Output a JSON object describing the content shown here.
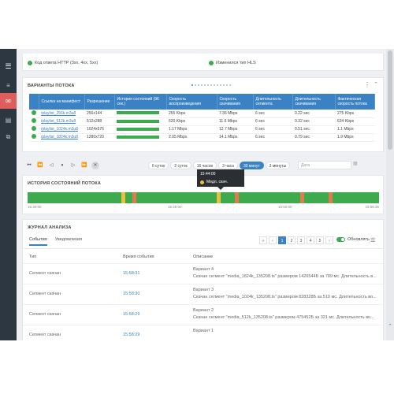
{
  "sidebar": {
    "items": [
      {
        "icon": "hamburger-menu-icon",
        "glyph": "☰"
      },
      {
        "icon": "list-icon",
        "glyph": "≡"
      },
      {
        "icon": "mail-icon",
        "glyph": "✉",
        "active": true
      },
      {
        "icon": "document-icon",
        "glyph": "▤"
      },
      {
        "icon": "copy-icon",
        "glyph": "⧉"
      }
    ]
  },
  "legend": {
    "http_code": "Код ответа HTTP (3xx, 4xx, 5xx)",
    "hls_type": "Изменился тип HLS"
  },
  "variants": {
    "title": "ВАРИАНТЫ ПОТОКА",
    "headers": [
      "",
      "Ссылка на манифест",
      "Разрешение",
      "История состояний (96 сек.)",
      "Скорость воспроизведения",
      "Скорость скачивания",
      "Длительность сегмента",
      "Длительность скачивания",
      "Фактическая скорость потока"
    ],
    "rows": [
      {
        "link": "/playlist_256k.m3u8",
        "resolution": "256x144",
        "play_speed": "255 Kbps",
        "dl_speed": "7.36 Mbps",
        "seg_dur": "6 sec",
        "dl_dur": "0.22 sec",
        "actual": "275 Kbps"
      },
      {
        "link": "/playlist_512k.m3u8",
        "resolution": "512x288",
        "play_speed": "620 Kbps",
        "dl_speed": "11.6 Mbps",
        "seg_dur": "6 sec",
        "dl_dur": "0.32 sec",
        "actual": "634 Kbps"
      },
      {
        "link": "/playlist_1024k.m3u8",
        "resolution": "1024x576",
        "play_speed": "1.17 Mbps",
        "dl_speed": "12.7 Mbps",
        "seg_dur": "6 sec",
        "dl_dur": "0.51 sec",
        "actual": "1.1 Mbps"
      },
      {
        "link": "/playlist_1824k.m3u8",
        "resolution": "1280x720",
        "play_speed": "2.05 Mbps",
        "dl_speed": "14.1 Mbps",
        "seg_dur": "6 sec",
        "dl_dur": "0.79 sec",
        "actual": "1.9 Mbps"
      }
    ]
  },
  "toolbar": {
    "ranges": [
      "6 суток",
      "2 суток",
      "16 часов",
      "3 часа",
      "30 минут",
      "3 минуты"
    ],
    "selected_range": "30 минут",
    "date_placeholder": "Дата"
  },
  "history": {
    "title": "ИСТОРИЯ СОСТОЯНИЙ ПОТОКА",
    "ticks": [
      "15:30:00",
      "15:40:00",
      "15:50:00",
      "15:58:35"
    ],
    "segments": [
      {
        "start": 0.266,
        "color": "#e6c23e"
      },
      {
        "start": 0.299,
        "color": "#e07b4e"
      },
      {
        "start": 0.538,
        "color": "#e6c23e"
      },
      {
        "start": 0.59,
        "color": "#e07b4e"
      },
      {
        "start": 0.775,
        "color": "#e07b4e"
      },
      {
        "start": 0.856,
        "color": "#e07b4e"
      }
    ],
    "tooltip": {
      "time": "15:44:00",
      "state": "Медл. скач."
    }
  },
  "journal": {
    "title": "ЖУРНАЛ АНАЛИЗА",
    "tabs": [
      "События",
      "Уведомления"
    ],
    "pages": [
      "‹‹",
      "‹",
      "1",
      "2",
      "3",
      "4",
      "5",
      "›"
    ],
    "refresh_label": "Обновлять",
    "columns": {
      "type": "Тип",
      "time": "Время события",
      "desc": "Описание"
    },
    "rows": [
      {
        "type": "Сегмент скачан",
        "time": "15:58:31",
        "variant": "Вариант 4",
        "detail": "Скачан сегмент \"media_1824k_135208.ts\" размером 1426544Б за 789 мс. Длительность в..."
      },
      {
        "type": "Сегмент скачан",
        "time": "15:58:30",
        "variant": "Вариант 3",
        "detail": "Скачан сегмент \"media_1024k_135208.ts\" размером 828328Б за 510 мс. Длительность во..."
      },
      {
        "type": "Сегмент скачан",
        "time": "15:58:29",
        "variant": "Вариант 2",
        "detail": "Скачан сегмент \"media_512k_135208.ts\" размером 475452Б за 321 мс. Длительность во..."
      },
      {
        "type": "Сегмент скачан",
        "time": "15:58:29",
        "variant": "Вариант 1",
        "detail": ""
      }
    ]
  }
}
